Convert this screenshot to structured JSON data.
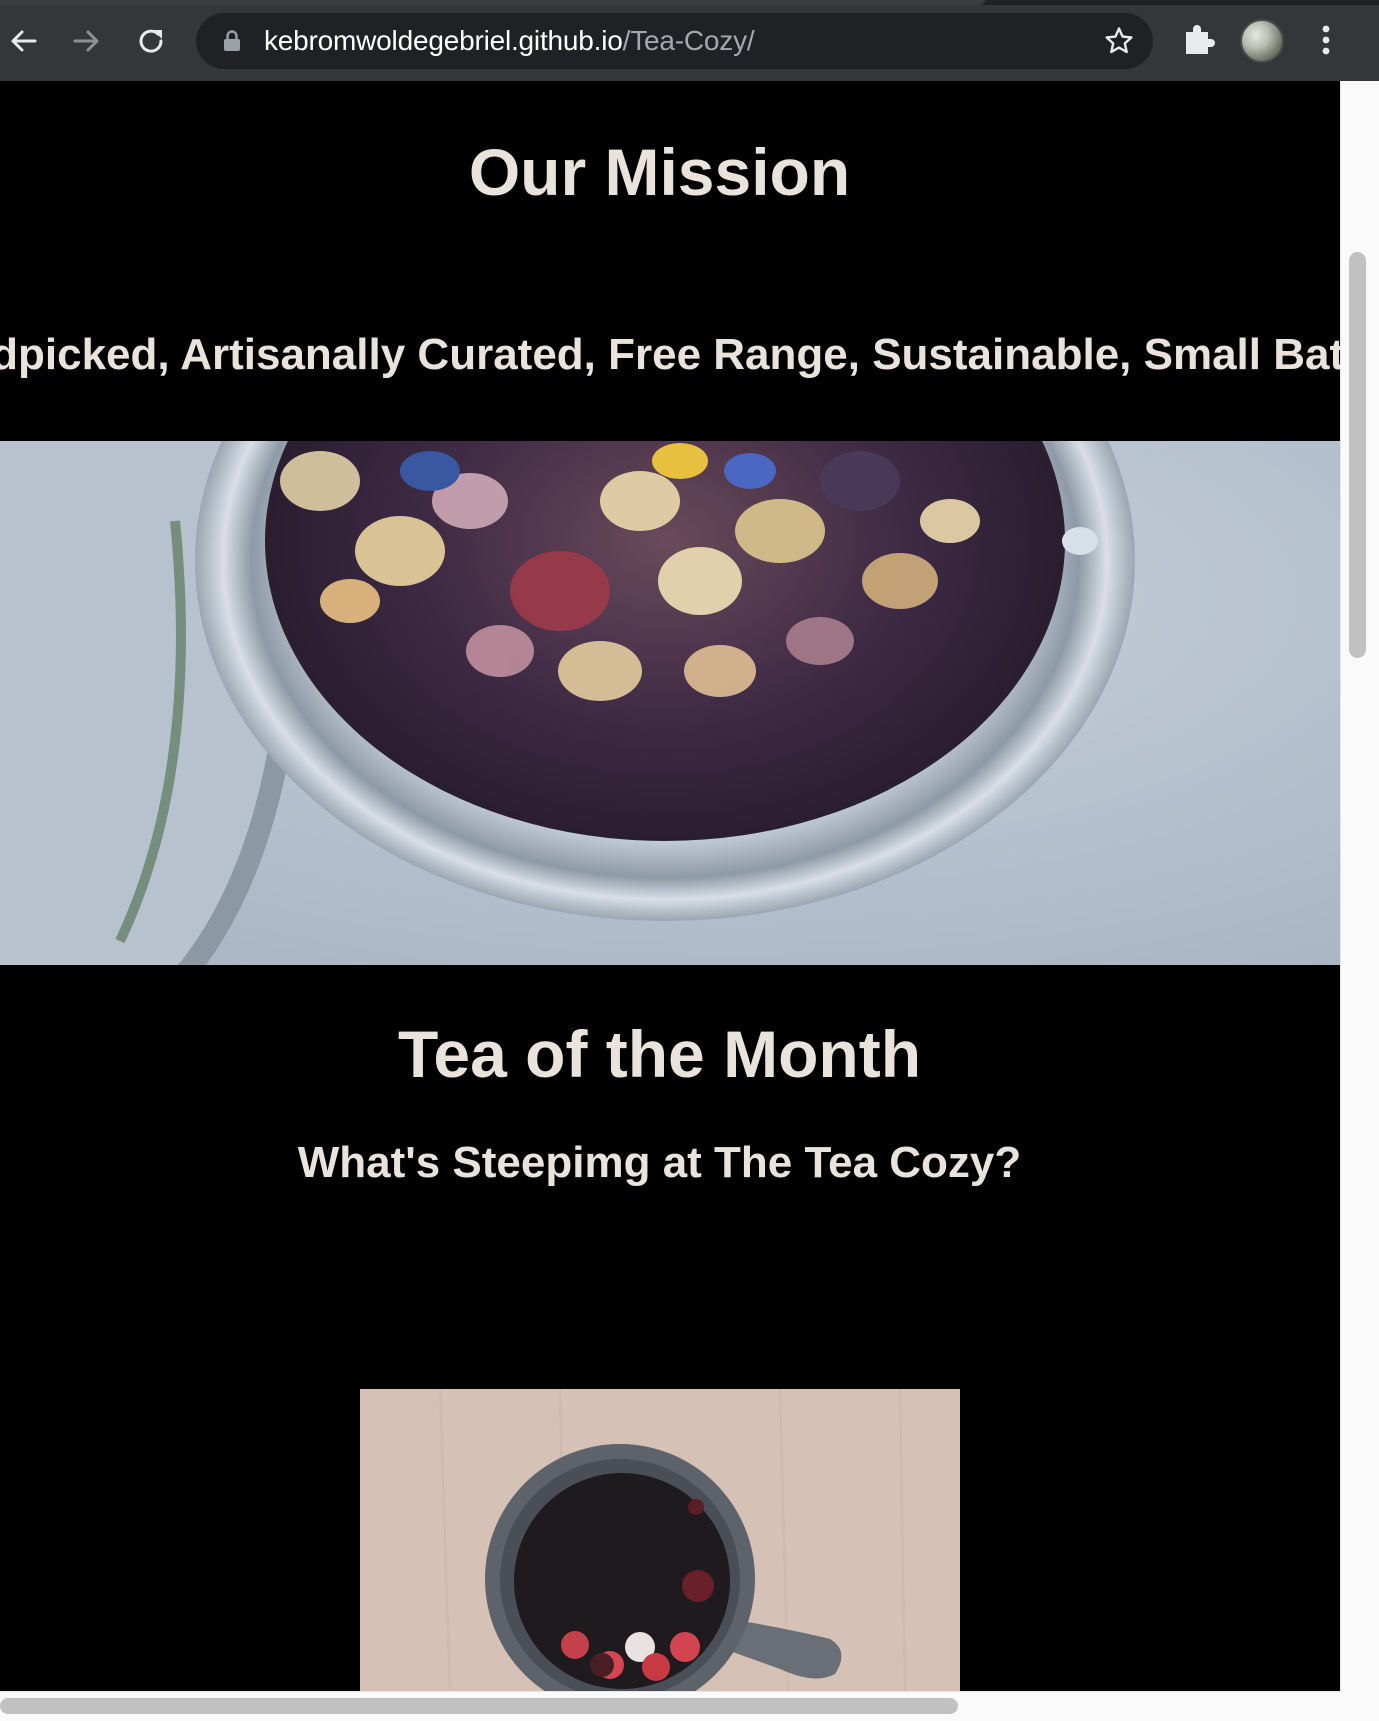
{
  "browser": {
    "url_host": "kebromwoldegebriel.github.io",
    "url_path": "/Tea-Cozy/"
  },
  "icons": {
    "back": "back-arrow-icon",
    "forward": "forward-arrow-icon",
    "reload": "reload-icon",
    "lock": "lock-icon",
    "bookmark": "star-icon",
    "extensions": "puzzle-icon",
    "profile": "avatar",
    "menu": "kebab-menu-icon"
  },
  "mission": {
    "title": "Our Mission",
    "tagline": "Handpicked, Artisanally Curated, Free Range, Sustainable, Small Batch, Fair Trade, Organic Tea"
  },
  "tea_of_month": {
    "title": "Tea of the Month",
    "subtitle": "What's Steepimg at The Tea Cozy?"
  },
  "colors": {
    "text": "#eae3dc",
    "background": "#000000",
    "toolbar": "#35363a",
    "omnibox": "#202124"
  }
}
